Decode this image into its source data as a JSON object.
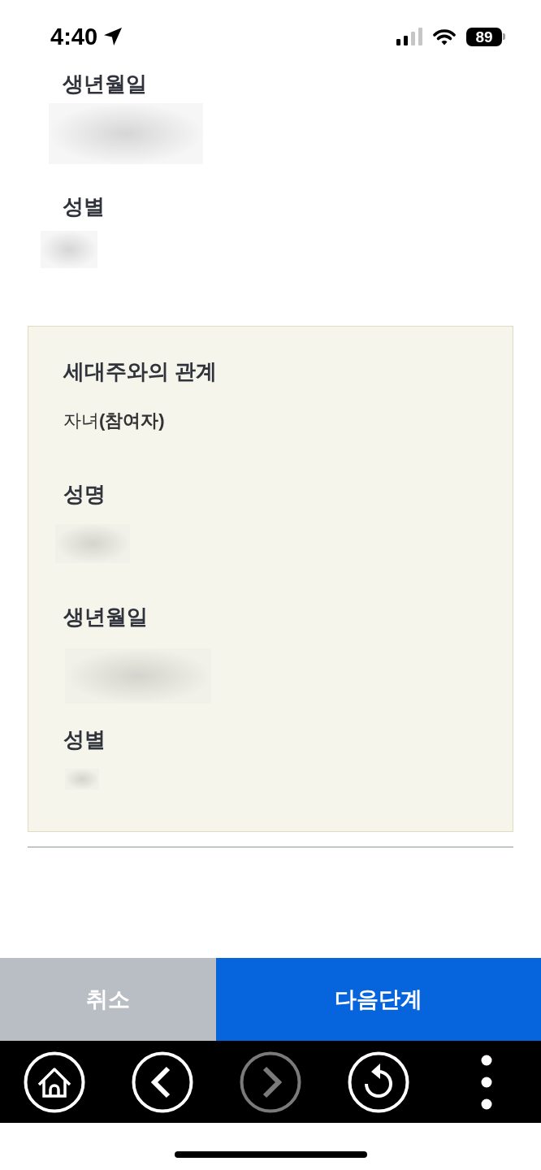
{
  "status_bar": {
    "time": "4:40",
    "battery": "89"
  },
  "top_fields": [
    {
      "label": "생년월일",
      "kind": "redacted"
    },
    {
      "label": "성별",
      "kind": "redacted"
    }
  ],
  "member_card": {
    "fields": [
      {
        "label": "세대주와의 관계",
        "kind": "text",
        "value": "자녀**(참여자)**"
      },
      {
        "label": "성명",
        "kind": "redacted"
      },
      {
        "label": "생년월일",
        "kind": "redacted"
      },
      {
        "label": "성별",
        "kind": "redacted"
      }
    ]
  },
  "buttons": [
    {
      "label": "취소",
      "kind": "secondary"
    },
    {
      "label": "다음단계",
      "kind": "primary"
    }
  ],
  "nav_bar": [
    {
      "kind": "home",
      "disabled": false
    },
    {
      "kind": "back",
      "disabled": false
    },
    {
      "kind": "forward",
      "disabled": true
    },
    {
      "kind": "reload",
      "disabled": false
    },
    {
      "kind": "more",
      "disabled": false
    }
  ]
}
